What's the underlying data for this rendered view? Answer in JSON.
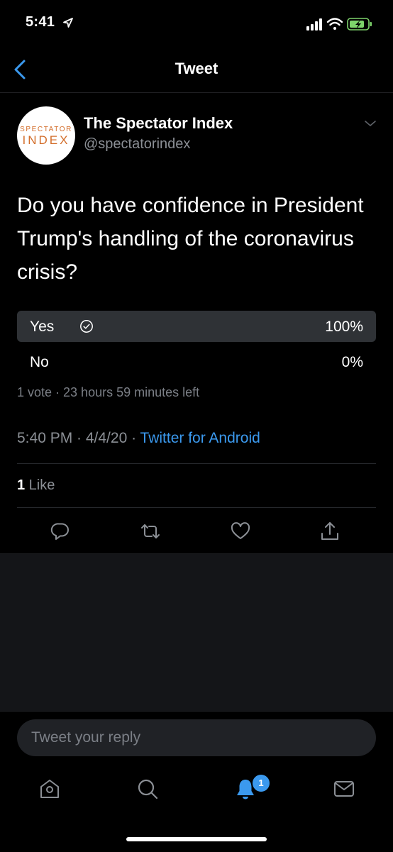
{
  "status_bar": {
    "time": "5:41"
  },
  "header": {
    "title": "Tweet"
  },
  "tweet": {
    "avatar": {
      "logo_line1": "SPECTATOR",
      "logo_line2": "INDEX"
    },
    "display_name": "The Spectator Index",
    "handle": "@spectatorindex",
    "text": "Do you have confidence in President Trump's handling of the coronavirus crisis?",
    "poll": {
      "options": [
        {
          "label": "Yes",
          "percent_text": "100%",
          "percent": 100,
          "selected": true
        },
        {
          "label": "No",
          "percent_text": "0%",
          "percent": 0,
          "selected": false
        }
      ],
      "meta": "1 vote · 23 hours 59 minutes left"
    },
    "timestamp": "5:40 PM · 4/4/20 · ",
    "source": "Twitter for Android",
    "likes_count": "1",
    "likes_label": " Like"
  },
  "reply": {
    "placeholder": "Tweet your reply"
  },
  "tab_bar": {
    "notifications_badge": "1"
  },
  "colors": {
    "accent": "#3b99ee",
    "background": "#000000",
    "poll_fill": "#2f3236",
    "secondary_text": "#8b8f95"
  },
  "icons": [
    "location-arrow-icon",
    "signal-icon",
    "wifi-icon",
    "battery-icon",
    "back-chevron-icon",
    "chevron-down-icon",
    "check-circle-icon",
    "reply-icon",
    "retweet-icon",
    "like-icon",
    "share-icon",
    "home-icon",
    "search-icon",
    "notifications-icon",
    "messages-icon"
  ]
}
